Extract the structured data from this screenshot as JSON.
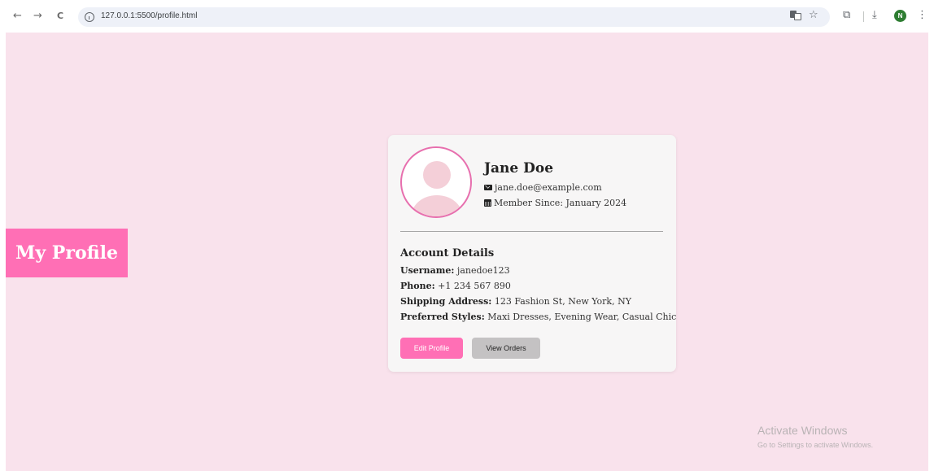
{
  "browser": {
    "back_glyph": "←",
    "forward_glyph": "→",
    "reload_glyph": "C",
    "url": "127.0.0.1:5500/profile.html",
    "star_glyph": "☆",
    "extensions_glyph": "⧉",
    "download_glyph": "⤓",
    "profile_initial": "N",
    "menu_glyph": "⋮",
    "icons": [
      "back-arrow-icon",
      "forward-arrow-icon",
      "reload-icon",
      "info-icon",
      "translate-icon",
      "bookmark-star-icon",
      "extensions-icon",
      "download-icon",
      "profile-avatar-icon",
      "menu-icon"
    ]
  },
  "sidebar": {
    "title": "My Profile"
  },
  "profile": {
    "name": "Jane Doe",
    "email": "jane.doe@example.com",
    "member_since": "Member Since: January 2024",
    "icons": [
      "envelope-icon",
      "calendar-icon",
      "avatar-placeholder-icon"
    ]
  },
  "account": {
    "title": "Account Details",
    "username_label": "Username:",
    "username_value": "janedoe123",
    "phone_label": "Phone:",
    "phone_value": "+1 234 567 890",
    "address_label": "Shipping Address:",
    "address_value": "123 Fashion St, New York, NY",
    "styles_label": "Preferred Styles:",
    "styles_value": "Maxi Dresses, Evening Wear, Casual Chic"
  },
  "actions": {
    "edit_label": "Edit Profile",
    "orders_label": "View Orders"
  },
  "watermark": {
    "title": "Activate Windows",
    "subtitle": "Go to Settings to activate Windows."
  },
  "colors": {
    "page_bg": "#f9e2ec",
    "accent_pink": "#ff6fb5",
    "card_bg": "#f7f6f6",
    "button_gray": "#c4c2c3",
    "avatar_border": "#e76fae"
  }
}
